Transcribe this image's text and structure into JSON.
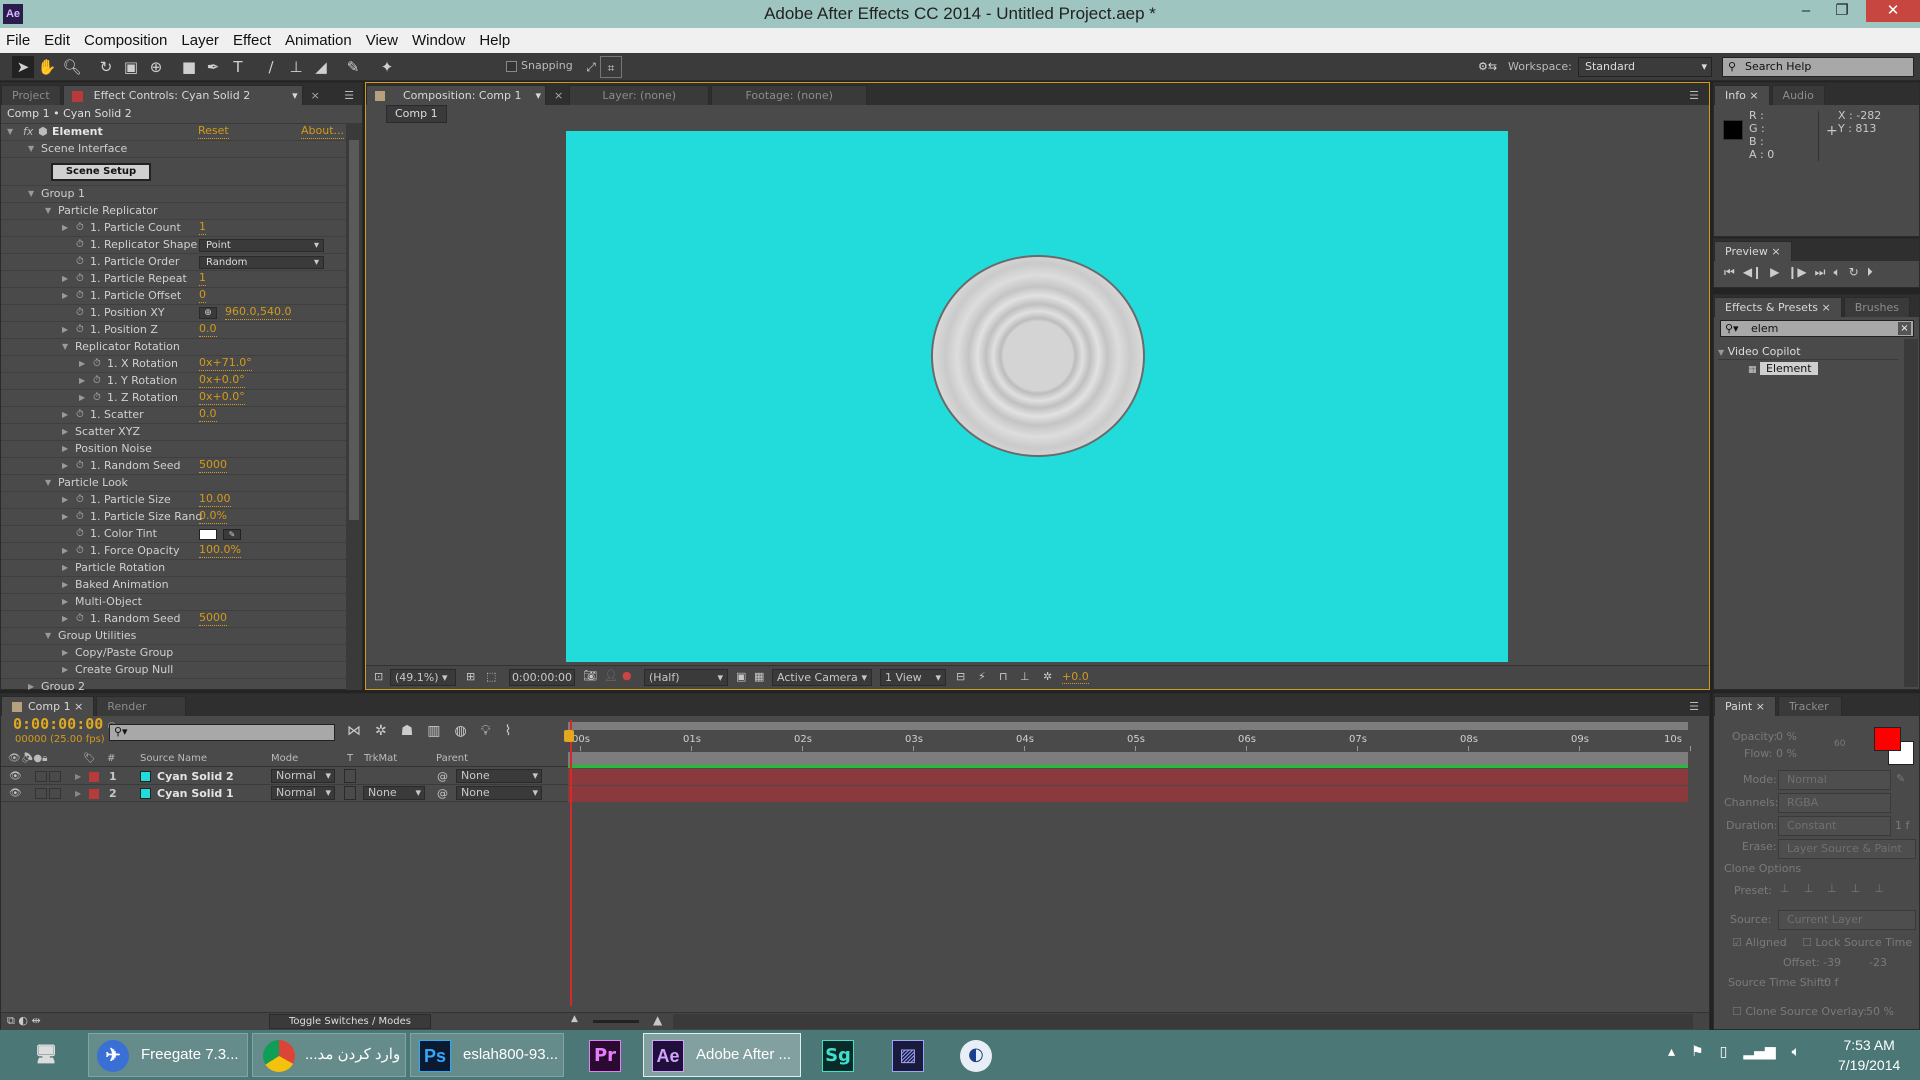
{
  "window": {
    "title": "Adobe After Effects CC 2014 - Untitled Project.aep *",
    "app_icon": "Ae"
  },
  "menu": [
    "File",
    "Edit",
    "Composition",
    "Layer",
    "Effect",
    "Animation",
    "View",
    "Window",
    "Help"
  ],
  "toolbar": {
    "snapping": "Snapping",
    "workspace_label": "Workspace:",
    "workspace": "Standard",
    "search_placeholder": "Search Help"
  },
  "left_panel": {
    "tabs": [
      "Project",
      "Effect Controls: Cyan Solid 2"
    ],
    "breadcrumb": "Comp 1 • Cyan Solid 2",
    "effect": {
      "name": "Element",
      "reset": "Reset",
      "about": "About..."
    },
    "scene_setup": "Scene Setup",
    "rows": [
      {
        "label": "Scene Interface",
        "level": 1,
        "twirl": "open"
      },
      {
        "label": "__button"
      },
      {
        "label": "Group 1",
        "level": 1,
        "twirl": "open"
      },
      {
        "label": "Particle Replicator",
        "level": 2,
        "twirl": "open"
      },
      {
        "label": "1. Particle Count",
        "level": 3,
        "twirl": "closed",
        "sw": true,
        "value": "1"
      },
      {
        "label": "1. Replicator Shape",
        "level": 3,
        "twirl": "none",
        "sw": true,
        "dropdown": "Point"
      },
      {
        "label": "1. Particle Order",
        "level": 3,
        "twirl": "none",
        "sw": true,
        "dropdown": "Random"
      },
      {
        "label": "1. Particle Repeat",
        "level": 3,
        "twirl": "closed",
        "sw": true,
        "value": "1"
      },
      {
        "label": "1. Particle Offset",
        "level": 3,
        "twirl": "closed",
        "sw": true,
        "value": "0"
      },
      {
        "label": "1. Position XY",
        "level": 3,
        "twirl": "none",
        "sw": true,
        "point": "960.0,540.0"
      },
      {
        "label": "1. Position Z",
        "level": 3,
        "twirl": "closed",
        "sw": true,
        "value": "0.0"
      },
      {
        "label": "Replicator Rotation",
        "level": 3,
        "twirl": "open"
      },
      {
        "label": "1. X Rotation",
        "level": 4,
        "twirl": "closed",
        "sw": true,
        "value": "0x+71.0°"
      },
      {
        "label": "1. Y Rotation",
        "level": 4,
        "twirl": "closed",
        "sw": true,
        "value": "0x+0.0°"
      },
      {
        "label": "1. Z Rotation",
        "level": 4,
        "twirl": "closed",
        "sw": true,
        "value": "0x+0.0°"
      },
      {
        "label": "1. Scatter",
        "level": 3,
        "twirl": "closed",
        "sw": true,
        "value": "0.0"
      },
      {
        "label": "Scatter XYZ",
        "level": 3,
        "twirl": "closed"
      },
      {
        "label": "Position Noise",
        "level": 3,
        "twirl": "closed"
      },
      {
        "label": "1. Random Seed",
        "level": 3,
        "twirl": "closed",
        "sw": true,
        "value": "5000"
      },
      {
        "label": "Particle Look",
        "level": 2,
        "twirl": "open"
      },
      {
        "label": "1. Particle Size",
        "level": 3,
        "twirl": "closed",
        "sw": true,
        "value": "10.00"
      },
      {
        "label": "1. Particle Size Rand",
        "level": 3,
        "twirl": "closed",
        "sw": true,
        "value": "0.0%"
      },
      {
        "label": "1. Color Tint",
        "level": 3,
        "twirl": "none",
        "sw": true,
        "color": "#ffffff"
      },
      {
        "label": "1. Force Opacity",
        "level": 3,
        "twirl": "closed",
        "sw": true,
        "value": "100.0%"
      },
      {
        "label": "Particle Rotation",
        "level": 3,
        "twirl": "closed"
      },
      {
        "label": "Baked Animation",
        "level": 3,
        "twirl": "closed"
      },
      {
        "label": "Multi-Object",
        "level": 3,
        "twirl": "closed"
      },
      {
        "label": "1. Random Seed",
        "level": 3,
        "twirl": "closed",
        "sw": true,
        "value": "5000"
      },
      {
        "label": "Group Utilities",
        "level": 2,
        "twirl": "open"
      },
      {
        "label": "Copy/Paste Group",
        "level": 3,
        "twirl": "closed"
      },
      {
        "label": "Create Group Null",
        "level": 3,
        "twirl": "closed"
      },
      {
        "label": "Group 2",
        "level": 1,
        "twirl": "closed"
      }
    ]
  },
  "comp_panel": {
    "tabs": [
      "Composition: Comp 1",
      "Layer: (none)",
      "Footage: (none)"
    ],
    "flow_tab": "Comp 1",
    "bg_color": "#22dcdc",
    "zoom": "(49.1%)",
    "time": "0:00:00:00",
    "resolution": "(Half)",
    "camera": "Active Camera",
    "views": "1 View",
    "exposure": "+0.0"
  },
  "info": {
    "tabs": [
      "Info",
      "Audio"
    ],
    "r": "R :",
    "g": "G :",
    "b": "B :",
    "a": "A : 0",
    "x": "X : -282",
    "y": "Y : 813"
  },
  "preview": {
    "tab": "Preview"
  },
  "effects_presets": {
    "tabs": [
      "Effects & Presets",
      "Brushes"
    ],
    "search": "elem",
    "category": "Video Copilot",
    "item": "Element"
  },
  "timeline": {
    "tabs": [
      "Comp 1",
      "Render Queue"
    ],
    "time": "0:00:00:00",
    "frames": "00000 (25.00 fps)",
    "columns": {
      "source": "Source Name",
      "mode": "Mode",
      "t": "T",
      "trkmat": "TrkMat",
      "parent": "Parent"
    },
    "layers": [
      {
        "num": "1",
        "name": "Cyan Solid 2",
        "mode": "Normal",
        "trkmat": "",
        "parent": "None",
        "label_color": "#b83a3a"
      },
      {
        "num": "2",
        "name": "Cyan Solid 1",
        "mode": "Normal",
        "trkmat": "None",
        "parent": "None",
        "label_color": "#b83a3a"
      }
    ],
    "ruler": [
      "00s",
      "01s",
      "02s",
      "03s",
      "04s",
      "05s",
      "06s",
      "07s",
      "08s",
      "09s",
      "10s"
    ],
    "toggle": "Toggle Switches / Modes"
  },
  "paint": {
    "tabs": [
      "Paint",
      "Tracker"
    ],
    "opacity_label": "Opacity:",
    "opacity": "0 %",
    "flow_label": "Flow:",
    "flow": "0 %",
    "brush_size": "60",
    "fg_color": "#ff0000",
    "bg_color": "#ffffff",
    "mode_label": "Mode:",
    "mode": "Normal",
    "channels_label": "Channels:",
    "channels": "RGBA",
    "duration_label": "Duration:",
    "duration": "Constant",
    "duration_frames": "1 f",
    "erase_label": "Erase:",
    "erase": "Layer Source & Paint",
    "clone_options": "Clone Options",
    "preset_label": "Preset:",
    "source_label": "Source:",
    "source": "Current Layer",
    "aligned": "Aligned",
    "lock_source": "Lock Source Time",
    "offset_label": "Offset:",
    "offset_x": "-39",
    "offset_y": "-23",
    "time_shift_label": "Source Time Shift:",
    "time_shift": "0 f",
    "overlay_label": "Clone Source Overlay:",
    "overlay": "50 %"
  },
  "taskbar": {
    "items": [
      {
        "label": "Freegate 7.3...",
        "icon": "freegate"
      },
      {
        "label": "...وارد کردن مد",
        "icon": "chrome"
      },
      {
        "label": "eslah800-93...",
        "icon": "Ps"
      },
      {
        "label": "",
        "icon": "Pr"
      },
      {
        "label": "Adobe After ...",
        "icon": "Ae"
      },
      {
        "label": "",
        "icon": "Sg"
      },
      {
        "label": "",
        "icon": "media-encoder"
      },
      {
        "label": "",
        "icon": "cinema4d"
      }
    ],
    "time": "7:53 AM",
    "date": "7/19/2014"
  }
}
